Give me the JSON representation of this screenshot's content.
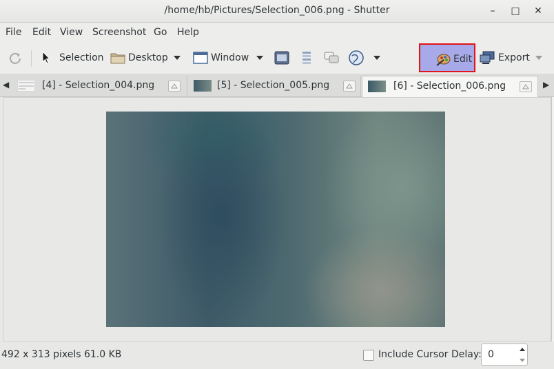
{
  "window": {
    "title": "/home/hb/Pictures/Selection_006.png - Shutter",
    "controls": {
      "minimize": "–",
      "maximize": "□",
      "close": "✕"
    }
  },
  "menubar": {
    "items": [
      "File",
      "Edit",
      "View",
      "Screenshot",
      "Go",
      "Help"
    ]
  },
  "toolbar": {
    "selection_label": "Selection",
    "desktop_label": "Desktop",
    "window_label": "Window",
    "edit_label": "Edit",
    "export_label": "Export",
    "icons": [
      "redo-icon",
      "cursor-icon",
      "folder-icon",
      "window-icon",
      "menu-icon",
      "tooltip-icon",
      "web-icon",
      "edit-icon",
      "export-icon"
    ],
    "accent_color": "#a7a9e8",
    "highlight_border": "#e0141b"
  },
  "tabs": [
    {
      "label": "[4] - Selection_004.png",
      "active": false
    },
    {
      "label": "[5] - Selection_005.png",
      "active": false
    },
    {
      "label": "[6] - Selection_006.png",
      "active": true
    }
  ],
  "status": {
    "info": "492 x 313 pixels  61.0 KB",
    "include_cursor_label": "Include Cursor",
    "include_cursor_checked": false,
    "delay_label": "Delay:",
    "delay_value": "0"
  }
}
